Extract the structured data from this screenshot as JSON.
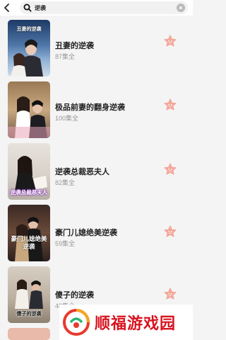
{
  "search": {
    "query": "逆袭"
  },
  "items": [
    {
      "title": "丑妻的逆袭",
      "count": "87集全",
      "poster_caption": "丑妻的逆袭"
    },
    {
      "title": "极品前妻的翻身逆袭",
      "count": "100集全",
      "poster_caption": ""
    },
    {
      "title": "逆袭总裁恶夫人",
      "count": "82集全",
      "poster_caption": "逆袭总裁恶夫人"
    },
    {
      "title": "豪门儿媳绝美逆袭",
      "count": "59集全",
      "poster_caption": "豪门儿媳绝美逆袭"
    },
    {
      "title": "傻子的逆袭",
      "count": "48集全",
      "poster_caption": "傻子的逆袭"
    }
  ],
  "watermark": {
    "text": "顺福游戏园"
  },
  "colors": {
    "accent": "#f3a89b",
    "watermark": "#d7131f"
  }
}
